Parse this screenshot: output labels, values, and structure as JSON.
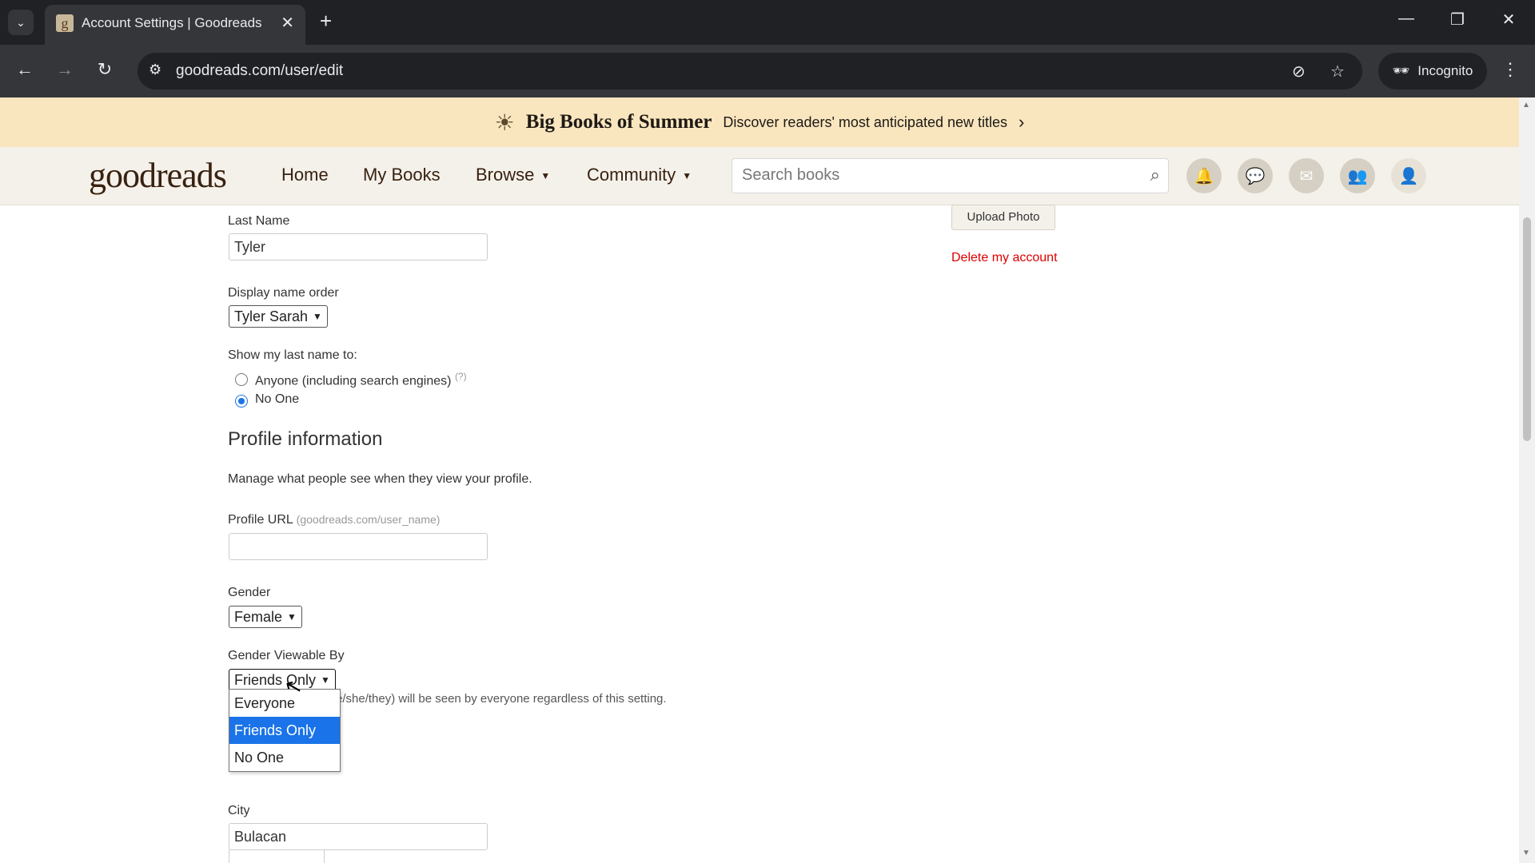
{
  "browser": {
    "tab_title": "Account Settings | Goodreads",
    "favicon_letter": "g",
    "url": "goodreads.com/user/edit",
    "incognito_label": "Incognito"
  },
  "banner": {
    "title": "Big Books of Summer",
    "subtitle": "Discover readers' most anticipated new titles"
  },
  "header": {
    "logo_light": "good",
    "logo_bold": "reads",
    "nav": [
      "Home",
      "My Books",
      "Browse",
      "Community"
    ],
    "search_placeholder": "Search books"
  },
  "form": {
    "last_name_label": "Last Name",
    "last_name_value": "Tyler",
    "display_order_label": "Display name order",
    "display_order_value": "Tyler Sarah",
    "show_last_name_label": "Show my last name to:",
    "radio_anyone": "Anyone (including search engines)",
    "radio_anyone_help": "(?)",
    "radio_noone": "No One",
    "profile_info_heading": "Profile information",
    "profile_info_desc": "Manage what people see when they view your profile.",
    "profile_url_label": "Profile URL",
    "profile_url_hint": "(goodreads.com/user_name)",
    "profile_url_value": "",
    "gender_label": "Gender",
    "gender_value": "Female",
    "gender_viewable_label": "Gender Viewable By",
    "gender_viewable_value": "Friends Only",
    "gender_note_fragment": "e/she/they) will be seen by everyone regardless of this setting.",
    "dropdown_options": [
      "Everyone",
      "Friends Only",
      "No One"
    ],
    "city_label": "City",
    "city_value": "Bulacan"
  },
  "sidebar": {
    "upload_photo": "Upload Photo",
    "delete_account": "Delete my account"
  }
}
